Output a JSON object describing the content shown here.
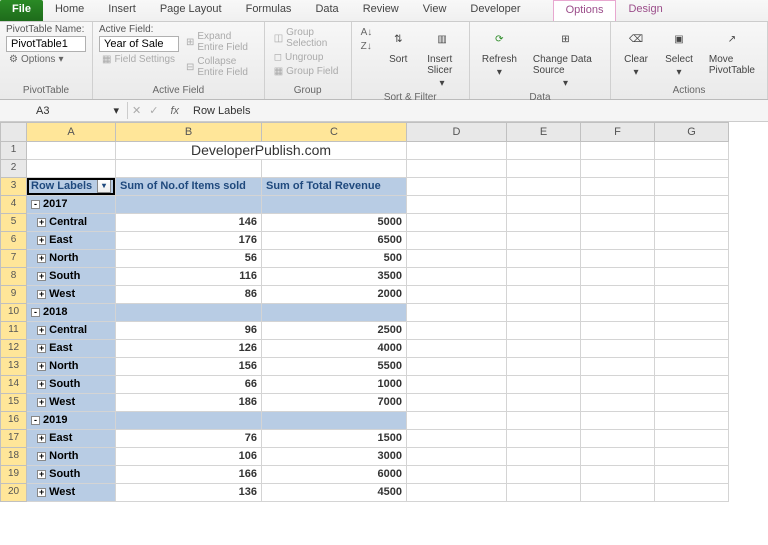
{
  "tabs": {
    "file": "File",
    "home": "Home",
    "insert": "Insert",
    "page_layout": "Page Layout",
    "formulas": "Formulas",
    "data": "Data",
    "review": "Review",
    "view": "View",
    "developer": "Developer",
    "options": "Options",
    "design": "Design"
  },
  "ribbon": {
    "pivottable": {
      "name_label": "PivotTable Name:",
      "name_value": "PivotTable1",
      "options": "Options",
      "group": "PivotTable"
    },
    "active_field": {
      "label": "Active Field:",
      "value": "Year of Sale",
      "settings": "Field Settings",
      "expand": "Expand Entire Field",
      "collapse": "Collapse Entire Field",
      "group": "Active Field"
    },
    "group": {
      "selection": "Group Selection",
      "ungroup": "Ungroup",
      "field": "Group Field",
      "group": "Group"
    },
    "sort_filter": {
      "sort": "Sort",
      "slicer": "Insert Slicer",
      "group": "Sort & Filter"
    },
    "data": {
      "refresh": "Refresh",
      "change": "Change Data Source",
      "group": "Data"
    },
    "actions": {
      "clear": "Clear",
      "select": "Select",
      "move": "Move PivotTable",
      "group": "Actions"
    }
  },
  "namebox": "A3",
  "formula": "Row Labels",
  "columns": [
    "A",
    "B",
    "C",
    "D",
    "E",
    "F",
    "G"
  ],
  "title_text": "DeveloperPublish.com",
  "headers": {
    "row_labels": "Row Labels",
    "col_b": "Sum of No.of Items sold",
    "col_c": "Sum of Total Revenue"
  },
  "rows": [
    {
      "r": 4,
      "type": "year",
      "label": "2017",
      "exp": "-"
    },
    {
      "r": 5,
      "type": "region",
      "label": "Central",
      "b": "146",
      "c": "5000"
    },
    {
      "r": 6,
      "type": "region",
      "label": "East",
      "b": "176",
      "c": "6500"
    },
    {
      "r": 7,
      "type": "region",
      "label": "North",
      "b": "56",
      "c": "500"
    },
    {
      "r": 8,
      "type": "region",
      "label": "South",
      "b": "116",
      "c": "3500"
    },
    {
      "r": 9,
      "type": "region",
      "label": "West",
      "b": "86",
      "c": "2000"
    },
    {
      "r": 10,
      "type": "year",
      "label": "2018",
      "exp": "-"
    },
    {
      "r": 11,
      "type": "region",
      "label": "Central",
      "b": "96",
      "c": "2500"
    },
    {
      "r": 12,
      "type": "region",
      "label": "East",
      "b": "126",
      "c": "4000"
    },
    {
      "r": 13,
      "type": "region",
      "label": "North",
      "b": "156",
      "c": "5500"
    },
    {
      "r": 14,
      "type": "region",
      "label": "South",
      "b": "66",
      "c": "1000"
    },
    {
      "r": 15,
      "type": "region",
      "label": "West",
      "b": "186",
      "c": "7000"
    },
    {
      "r": 16,
      "type": "year",
      "label": "2019",
      "exp": "-"
    },
    {
      "r": 17,
      "type": "region",
      "label": "East",
      "b": "76",
      "c": "1500"
    },
    {
      "r": 18,
      "type": "region",
      "label": "North",
      "b": "106",
      "c": "3000"
    },
    {
      "r": 19,
      "type": "region",
      "label": "South",
      "b": "166",
      "c": "6000"
    },
    {
      "r": 20,
      "type": "region",
      "label": "West",
      "b": "136",
      "c": "4500"
    }
  ]
}
